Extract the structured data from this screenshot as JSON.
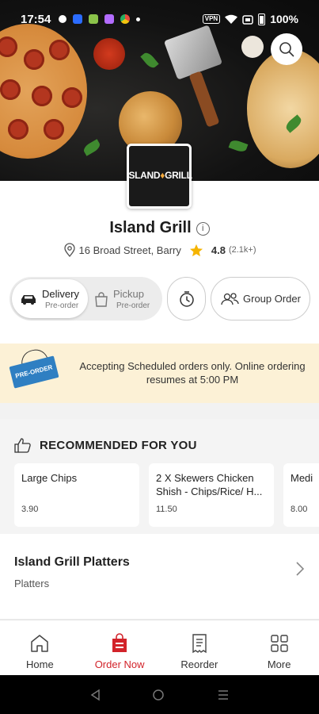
{
  "status_bar": {
    "time": "17:54",
    "vpn": "VPN",
    "battery": "100%"
  },
  "restaurant": {
    "logo_main": "ISLAND",
    "logo_sep": "♦",
    "logo_second": "GRILL",
    "logo_tagline": "",
    "name": "Island Grill",
    "info_symbol": "i",
    "address": "16 Broad Street, Barry",
    "rating": "4.8",
    "rating_count": "(2.1k+)"
  },
  "order_mode": {
    "delivery_label": "Delivery",
    "delivery_sub": "Pre-order",
    "pickup_label": "Pickup",
    "pickup_sub": "Pre-order",
    "group_order_label": "Group Order"
  },
  "banner": {
    "tag_text": "PRE-ORDER",
    "message": "Accepting Scheduled orders only. Online ordering resumes at 5:00 PM",
    "bg_color": "#fcf1d6"
  },
  "recommended": {
    "heading": "RECOMMENDED FOR YOU",
    "items": [
      {
        "name": "Large Chips",
        "price": "3.90"
      },
      {
        "name": "2 X Skewers Chicken Shish - Chips/Rice/ H...",
        "price": "11.50"
      },
      {
        "name": "Medi",
        "price": "8.00"
      }
    ]
  },
  "category": {
    "title": "Island Grill Platters",
    "subtitle": "Platters"
  },
  "nav": {
    "items": [
      {
        "label": "Home",
        "icon": "home-icon"
      },
      {
        "label": "Order Now",
        "icon": "order-bag-icon"
      },
      {
        "label": "Reorder",
        "icon": "receipt-icon"
      },
      {
        "label": "More",
        "icon": "grid-icon"
      }
    ],
    "active_color": "#d2232a"
  }
}
